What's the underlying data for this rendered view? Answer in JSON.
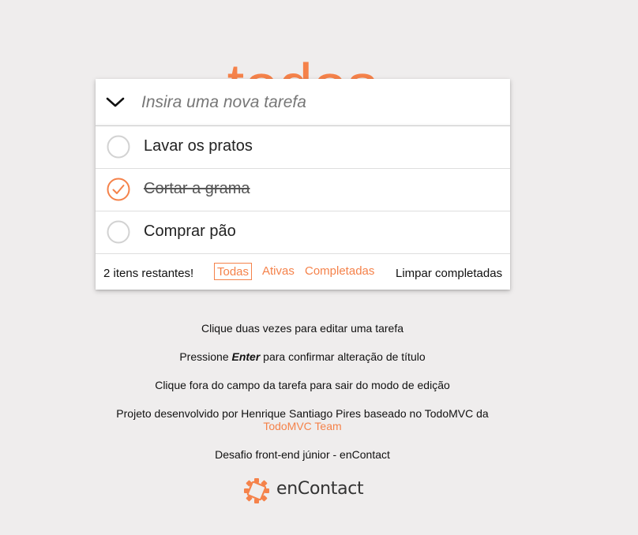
{
  "header": {
    "title": "todos"
  },
  "new_todo": {
    "placeholder": "Insira uma nova tarefa",
    "value": ""
  },
  "todos": [
    {
      "label": "Lavar os pratos",
      "completed": false
    },
    {
      "label": "Cortar a grama",
      "completed": true
    },
    {
      "label": "Comprar pão",
      "completed": false
    }
  ],
  "footer": {
    "count": "2 itens restantes!",
    "filters": [
      "Todas",
      "Ativas",
      "Completadas"
    ],
    "selected_filter": "Todas",
    "clear": "Limpar completadas"
  },
  "info": {
    "line1": "Clique duas vezes para editar uma tarefa",
    "line2_pre": "Pressione ",
    "line2_key": "Enter",
    "line2_post": " para confirmar alteração de título",
    "line3": "Clique fora do campo da tarefa para sair do modo de edição",
    "line4": "Projeto desenvolvido por Henrique Santiago Pires baseado no TodoMVC da",
    "line4_link": "TodoMVC Team",
    "line5": "Desafio front-end júnior - enContact"
  },
  "brand": {
    "name": "enContact",
    "icon": "encontact-logo"
  },
  "colors": {
    "accent": "#f5824a",
    "background": "#efeded"
  }
}
